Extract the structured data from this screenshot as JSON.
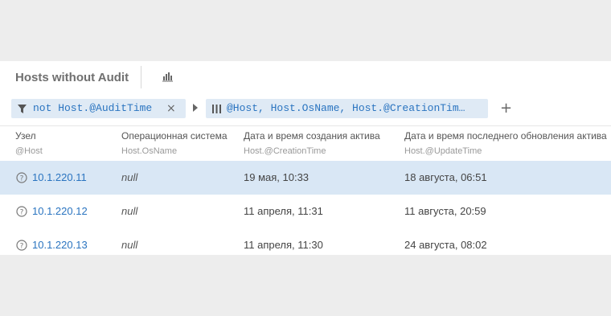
{
  "query": {
    "title": "Hosts without Audit",
    "filter": "not Host.@AuditTime",
    "columns": "@Host, Host.OsName, Host.@CreationTim…"
  },
  "table": {
    "headers": [
      {
        "label": "Узел",
        "field": "@Host"
      },
      {
        "label": "Операционная система",
        "field": "Host.OsName"
      },
      {
        "label": "Дата и время создания актива",
        "field": "Host.@CreationTime"
      },
      {
        "label": "Дата и время последнего обновления актива",
        "field": "Host.@UpdateTime"
      }
    ],
    "rows": [
      {
        "host": "10.1.220.11",
        "os": "null",
        "created": "19 мая, 10:33",
        "updated": "18 августа, 06:51",
        "selected": true
      },
      {
        "host": "10.1.220.12",
        "os": "null",
        "created": "11 апреля, 11:31",
        "updated": "11 августа, 20:59",
        "selected": false
      },
      {
        "host": "10.1.220.13",
        "os": "null",
        "created": "11 апреля, 11:30",
        "updated": "24 августа, 08:02",
        "selected": false
      }
    ]
  },
  "icons": {
    "chart": "bar-chart-icon",
    "filter": "filter-icon",
    "remove": "close-icon",
    "columns": "columns-icon",
    "arrow": "chevron-right-icon",
    "add": "plus-icon",
    "row_status": "question-circle-icon"
  },
  "colors": {
    "accent": "#2a74c0",
    "chip_bg": "#dfeaf5",
    "selected_row": "#d9e7f5"
  }
}
